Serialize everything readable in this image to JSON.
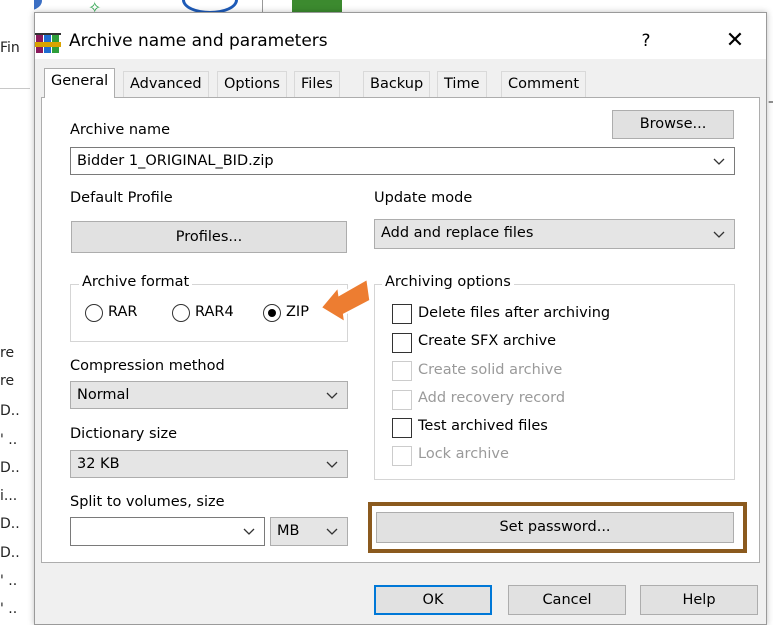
{
  "background": {
    "top_fragments": [
      "—"
    ],
    "left_fragments": [
      "Fin",
      "re",
      "re",
      "D..",
      "' ..",
      "D..",
      "i...",
      "D..",
      "D..",
      "' ..",
      "' .."
    ]
  },
  "dialog": {
    "title": "Archive name and parameters",
    "help_glyph": "?",
    "close_glyph": "✕",
    "icon": "winrar-books-icon"
  },
  "tabs": [
    {
      "label": "General",
      "active": true
    },
    {
      "label": "Advanced",
      "active": false
    },
    {
      "label": "Options",
      "active": false
    },
    {
      "label": "Files",
      "active": false
    },
    {
      "label": "Backup",
      "active": false
    },
    {
      "label": "Time",
      "active": false
    },
    {
      "label": "Comment",
      "active": false
    }
  ],
  "general": {
    "archive_name_label": "Archive name",
    "browse_label": "Browse...",
    "archive_name_value": "Bidder 1_ORIGINAL_BID.zip",
    "default_profile_label": "Default Profile",
    "profiles_label": "Profiles...",
    "update_mode_label": "Update mode",
    "update_mode_value": "Add and replace files",
    "archive_format_label": "Archive format",
    "formats": [
      {
        "label": "RAR",
        "selected": false
      },
      {
        "label": "RAR4",
        "selected": false
      },
      {
        "label": "ZIP",
        "selected": true
      }
    ],
    "compression_method_label": "Compression method",
    "compression_method_value": "Normal",
    "dictionary_size_label": "Dictionary size",
    "dictionary_size_value": "32 KB",
    "split_label": "Split to volumes, size",
    "split_value": "",
    "split_unit": "MB",
    "archiving_options_label": "Archiving options",
    "options": [
      {
        "label": "Delete files after archiving",
        "checked": false,
        "enabled": true
      },
      {
        "label": "Create SFX archive",
        "checked": false,
        "enabled": true
      },
      {
        "label": "Create solid archive",
        "checked": false,
        "enabled": false
      },
      {
        "label": "Add recovery record",
        "checked": false,
        "enabled": false
      },
      {
        "label": "Test archived files",
        "checked": false,
        "enabled": true
      },
      {
        "label": "Lock archive",
        "checked": false,
        "enabled": false
      }
    ],
    "set_password_label": "Set password..."
  },
  "footer": {
    "ok_label": "OK",
    "cancel_label": "Cancel",
    "help_label": "Help"
  },
  "colors": {
    "callout_arrow": "#ed7d31",
    "highlight_box": "#8b5a1e",
    "default_button_border": "#0078d7"
  }
}
